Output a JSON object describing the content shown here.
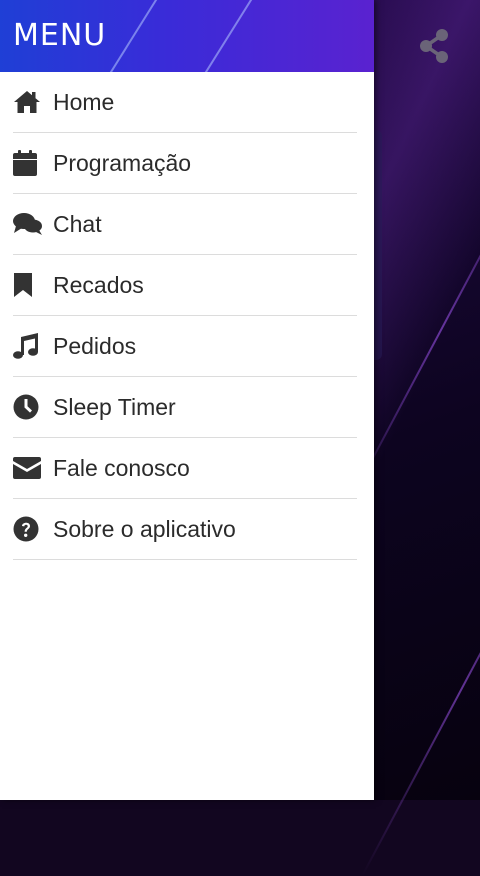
{
  "drawer": {
    "title": "MENU",
    "items": [
      {
        "label": "Home",
        "icon": "home-icon"
      },
      {
        "label": "Programação",
        "icon": "calendar-icon"
      },
      {
        "label": "Chat",
        "icon": "chat-icon"
      },
      {
        "label": "Recados",
        "icon": "bookmark-icon"
      },
      {
        "label": "Pedidos",
        "icon": "music-note-icon"
      },
      {
        "label": "Sleep Timer",
        "icon": "clock-icon"
      },
      {
        "label": "Fale conosco",
        "icon": "envelope-icon"
      },
      {
        "label": "Sobre o aplicativo",
        "icon": "question-circle-icon"
      }
    ]
  },
  "app": {
    "share_icon": "share-icon"
  },
  "colors": {
    "header_gradient_start": "#1f3fd6",
    "header_gradient_end": "#5a22d0",
    "background_dark": "#120620",
    "icon_color": "#333333"
  }
}
